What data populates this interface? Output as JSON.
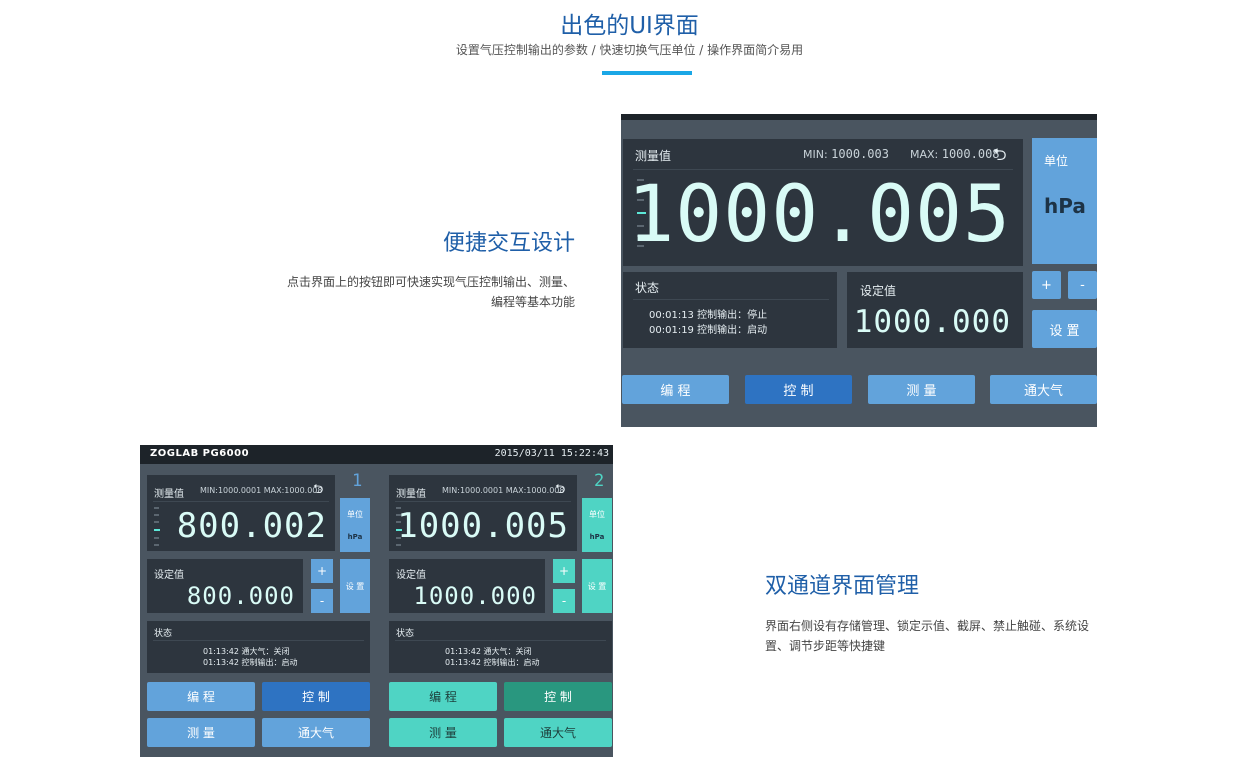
{
  "header": {
    "title": "出色的UI界面",
    "subtitle": "设置气压控制输出的参数 / 快速切换气压单位 / 操作界面简介易用"
  },
  "feature1": {
    "title": "便捷交互设计",
    "desc_line1": "点击界面上的按钮即可快速实现气压控制输出、测量、",
    "desc_line2": "编程等基本功能"
  },
  "feature2": {
    "title": "双通道界面管理",
    "desc": "界面右侧设有存储管理、锁定示值、截屏、禁止触碰、系统设置、调节步距等快捷键"
  },
  "screen1": {
    "meas_label": "测量值",
    "min_label": "MIN:",
    "min_value": "1000.003",
    "max_label": "MAX:",
    "max_value": "1000.008",
    "undo_icon": "⮌",
    "measured_value": "1000.005",
    "unit_label": "单位",
    "unit_value": "hPa",
    "state_label": "状态",
    "state_lines": [
      "00:01:13  控制输出：停止",
      "00:01:19  控制输出：启动"
    ],
    "set_label": "设定值",
    "set_value": "1000.000",
    "plus": "+",
    "minus": "-",
    "set_button": "设 置",
    "tabs": [
      "编 程",
      "控 制",
      "测 量",
      "通大气"
    ]
  },
  "screen2": {
    "brand": "ZOGLAB  PG6000",
    "datetime": "2015/03/11   15:22:43",
    "channels": [
      {
        "number": "1",
        "meas_label": "测量值",
        "minmax": "MIN:1000.0001   MAX:1000.008",
        "measured_value": "800.002",
        "unit_label": "单位",
        "unit_value": "hPa",
        "set_label": "设定值",
        "set_value": "800.000",
        "plus": "+",
        "minus": "-",
        "set_button": "设 置",
        "state_label": "状态",
        "state_lines": [
          "01:13:42  通大气：关闭",
          "01:13:42  控制输出：启动"
        ],
        "buttons": [
          "编 程",
          "控 制",
          "测 量",
          "通大气"
        ]
      },
      {
        "number": "2",
        "meas_label": "测量值",
        "minmax": "MIN:1000.0001   MAX:1000.008",
        "measured_value": "1000.005",
        "unit_label": "单位",
        "unit_value": "hPa",
        "set_label": "设定值",
        "set_value": "1000.000",
        "plus": "+",
        "minus": "-",
        "set_button": "设 置",
        "state_label": "状态",
        "state_lines": [
          "01:13:42  通大气：关闭",
          "01:13:42  控制输出：启动"
        ],
        "buttons": [
          "编 程",
          "控 制",
          "测 量",
          "通大气"
        ]
      }
    ]
  },
  "colors": {
    "accent": "#1f5fa8",
    "underline": "#1aa7e6",
    "light_blue_button": "#62a3db",
    "dark_blue_button": "#2e73c2",
    "teal_button": "#4fd4c4",
    "dark_teal_button": "#29977f",
    "panel": "#2d353e",
    "screen_bg": "#4a5560"
  }
}
